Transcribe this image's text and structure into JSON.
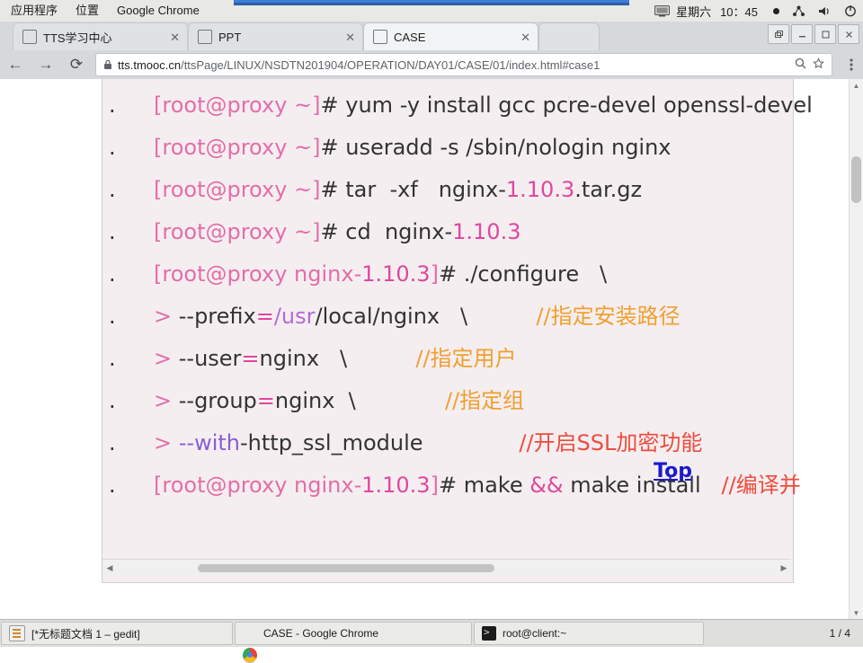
{
  "system_bar": {
    "applications_label": "应用程序",
    "places_label": "位置",
    "active_app_label": "Google Chrome",
    "weekday": "星期六",
    "clock": "10：45",
    "icons": [
      "screen-icon",
      "record-dot-icon",
      "network-icon",
      "volume-icon",
      "power-icon"
    ]
  },
  "browser": {
    "tabs": [
      {
        "title": "TTS学习中心",
        "close": "✕"
      },
      {
        "title": "PPT",
        "close": "✕"
      },
      {
        "title": "CASE",
        "close": "✕"
      }
    ],
    "window_buttons": [
      "restore",
      "minimize",
      "maximize",
      "close"
    ],
    "nav": {
      "back": "←",
      "forward": "→",
      "reload": "⟳"
    },
    "omnibox": {
      "lock_icon": "lock-icon",
      "url_host": "tts.tmooc.cn",
      "url_path": "/ttsPage/LINUX/NSDTN201904/OPERATION/DAY01/CASE/01/index.html#case1",
      "zoom_icon": "search-zoom-icon",
      "star_icon": "bookmark-star-icon",
      "menu_icon": "three-dots-menu-icon"
    }
  },
  "slide": {
    "top_link": "Top",
    "lines": [
      {
        "bullet": ".",
        "parts": [
          {
            "t": "[root@proxy ~]",
            "c": "pink"
          },
          {
            "t": "# yum ",
            "c": "dark"
          },
          {
            "t": "-y",
            "c": "dark"
          },
          {
            "t": " install gcc pcre-devel openssl-devel",
            "c": "dark"
          }
        ]
      },
      {
        "bullet": ".",
        "parts": [
          {
            "t": "[root@proxy ~]",
            "c": "pink"
          },
          {
            "t": "# useradd ",
            "c": "dark"
          },
          {
            "t": "-s",
            "c": "dark"
          },
          {
            "t": " /sbin/nologin nginx",
            "c": "dark"
          }
        ]
      },
      {
        "bullet": ".",
        "parts": [
          {
            "t": "[root@proxy ~]",
            "c": "pink"
          },
          {
            "t": "# tar  -xf   nginx-",
            "c": "dark"
          },
          {
            "t": "1.10.3",
            "c": "magenta"
          },
          {
            "t": ".tar.gz",
            "c": "dark"
          }
        ]
      },
      {
        "bullet": ".",
        "parts": [
          {
            "t": "[root@proxy ~]",
            "c": "pink"
          },
          {
            "t": "# cd  nginx-",
            "c": "dark"
          },
          {
            "t": "1.10.3",
            "c": "magenta"
          }
        ]
      },
      {
        "bullet": ".",
        "parts": [
          {
            "t": "[root@proxy nginx-",
            "c": "pink"
          },
          {
            "t": "1.10.3",
            "c": "magenta"
          },
          {
            "t": "]",
            "c": "pink"
          },
          {
            "t": "# ./configure   \\",
            "c": "dark"
          }
        ]
      },
      {
        "bullet": ".",
        "parts": [
          {
            "t": "> ",
            "c": "pink"
          },
          {
            "t": "--prefix",
            "c": "dark"
          },
          {
            "t": "=",
            "c": "magenta"
          },
          {
            "t": "/usr",
            "c": "purple"
          },
          {
            "t": "/local/nginx   \\",
            "c": "dark"
          },
          {
            "t": "          ",
            "c": "dark"
          },
          {
            "t": "//指定安装路径",
            "c": "orange"
          }
        ]
      },
      {
        "bullet": ".",
        "parts": [
          {
            "t": "> ",
            "c": "pink"
          },
          {
            "t": "--user",
            "c": "dark"
          },
          {
            "t": "=",
            "c": "magenta"
          },
          {
            "t": "nginx   \\",
            "c": "dark"
          },
          {
            "t": "          ",
            "c": "dark"
          },
          {
            "t": "//指定用户",
            "c": "orange"
          }
        ]
      },
      {
        "bullet": ".",
        "parts": [
          {
            "t": "> ",
            "c": "pink"
          },
          {
            "t": "--group",
            "c": "dark"
          },
          {
            "t": "=",
            "c": "magenta"
          },
          {
            "t": "nginx  \\",
            "c": "dark"
          },
          {
            "t": "             ",
            "c": "dark"
          },
          {
            "t": "//指定组",
            "c": "orange"
          }
        ]
      },
      {
        "bullet": ".",
        "parts": [
          {
            "t": "> ",
            "c": "pink"
          },
          {
            "t": "--with",
            "c": "violet"
          },
          {
            "t": "-http_ssl_module",
            "c": "dark"
          },
          {
            "t": "              ",
            "c": "dark"
          },
          {
            "t": "//开启SSL加密功能",
            "c": "red"
          }
        ]
      },
      {
        "bullet": ".",
        "parts": []
      },
      {
        "bullet": ".",
        "parts": [
          {
            "t": "[root@proxy nginx-",
            "c": "pink"
          },
          {
            "t": "1.10.3",
            "c": "magenta"
          },
          {
            "t": "]",
            "c": "pink"
          },
          {
            "t": "# make ",
            "c": "dark"
          },
          {
            "t": "&&",
            "c": "magenta"
          },
          {
            "t": " make install",
            "c": "dark"
          },
          {
            "t": "   ",
            "c": "dark"
          },
          {
            "t": "//编译并",
            "c": "red"
          }
        ]
      }
    ]
  },
  "taskbar": {
    "items": [
      {
        "icon": "gedit-icon",
        "label": "[*无标题文档 1 – gedit]"
      },
      {
        "icon": "chrome-icon",
        "label": "CASE - Google Chrome"
      },
      {
        "icon": "terminal-icon",
        "label": "root@client:~"
      }
    ],
    "pager": "1 / 4"
  },
  "colors": {
    "pink": "#e36ea8",
    "magenta": "#e0479e",
    "purple": "#b36bd4",
    "violet": "#8a5fd0",
    "orange": "#f0a030",
    "red": "#ef4b3c",
    "link_blue": "#1a1acc",
    "page_bg": "#f5eef1"
  }
}
